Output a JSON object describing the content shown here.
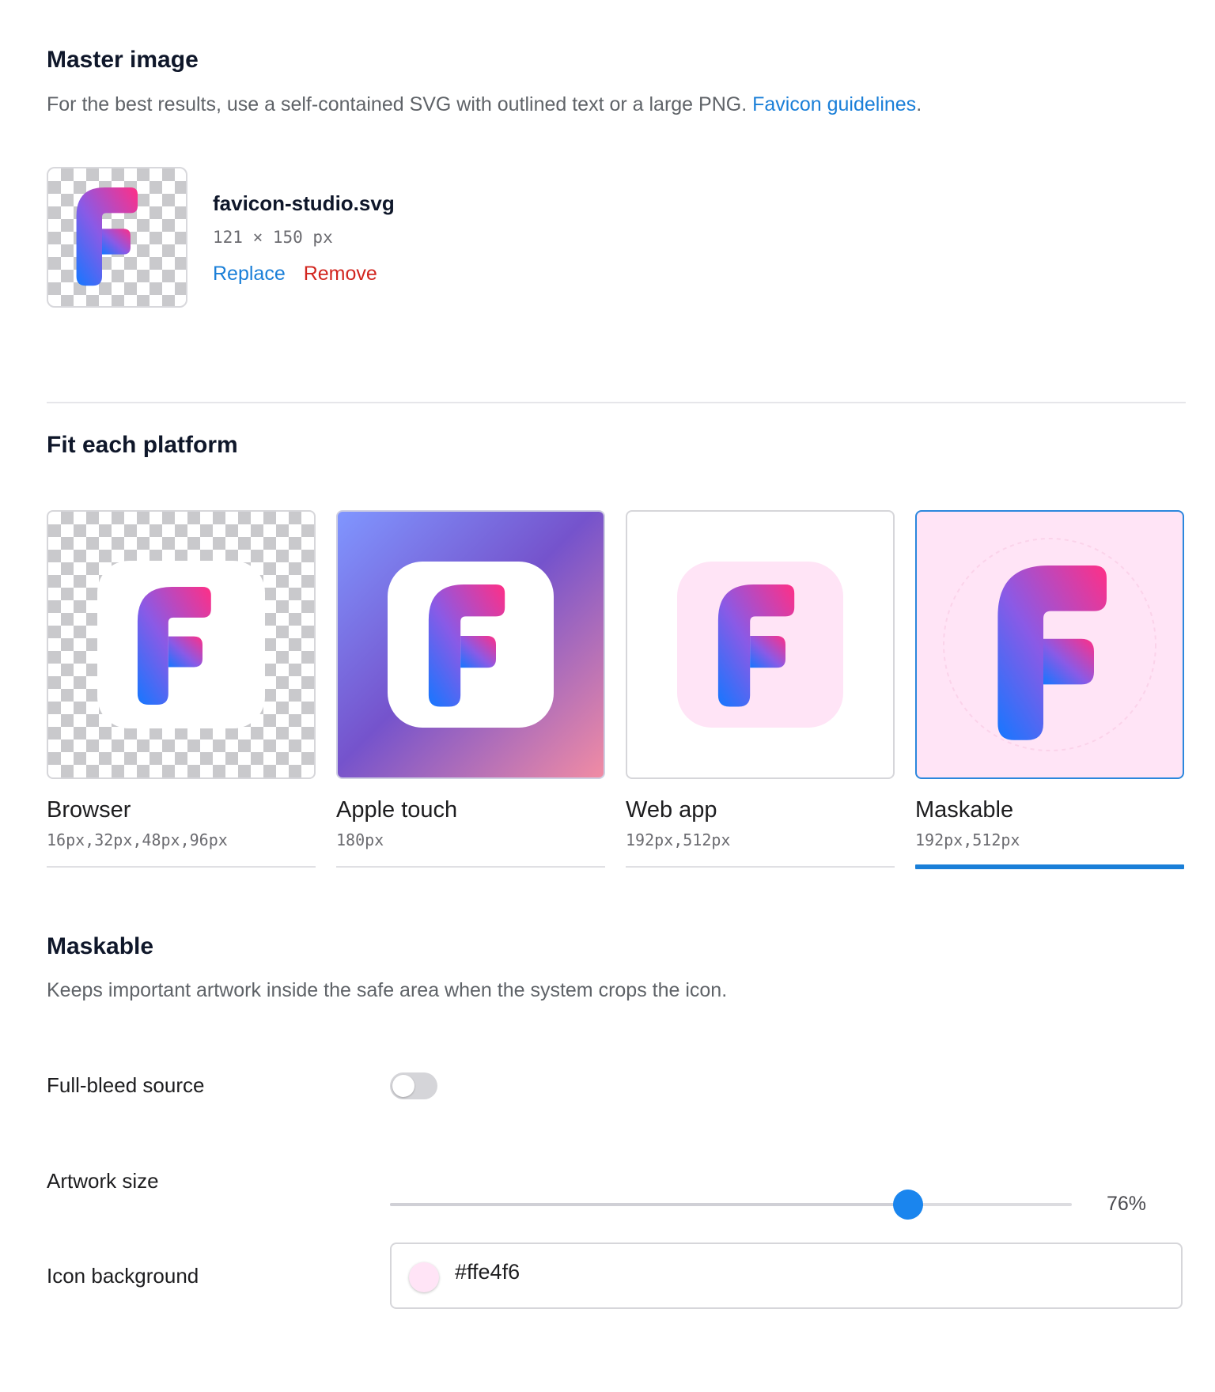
{
  "master": {
    "title": "Master image",
    "description": "For the best results, use a self-contained SVG with outlined text or a large PNG. ",
    "guidelines_link": "Favicon guidelines",
    "guidelines_suffix": ".",
    "file_name": "favicon-studio.svg",
    "file_dims": "121 × 150 px",
    "replace_label": "Replace",
    "remove_label": "Remove"
  },
  "platforms": {
    "title": "Fit each platform",
    "items": [
      {
        "label": "Browser",
        "sizes": "16px,32px,48px,96px",
        "selected": false
      },
      {
        "label": "Apple touch",
        "sizes": "180px",
        "selected": false
      },
      {
        "label": "Web app",
        "sizes": "192px,512px",
        "selected": false
      },
      {
        "label": "Maskable",
        "sizes": "192px,512px",
        "selected": true
      }
    ]
  },
  "maskable": {
    "title": "Maskable",
    "description": "Keeps important artwork inside the safe area when the system crops the icon.",
    "full_bleed_label": "Full-bleed source",
    "full_bleed_on": false,
    "artwork_size_label": "Artwork size",
    "artwork_size_value": "76%",
    "artwork_size_fraction": 0.76,
    "icon_background_label": "Icon background",
    "icon_background_value": "#ffe4f6"
  },
  "colors": {
    "accent": "#1a7fd8",
    "danger": "#d2261f",
    "icon_background": "#ffe4f6"
  }
}
